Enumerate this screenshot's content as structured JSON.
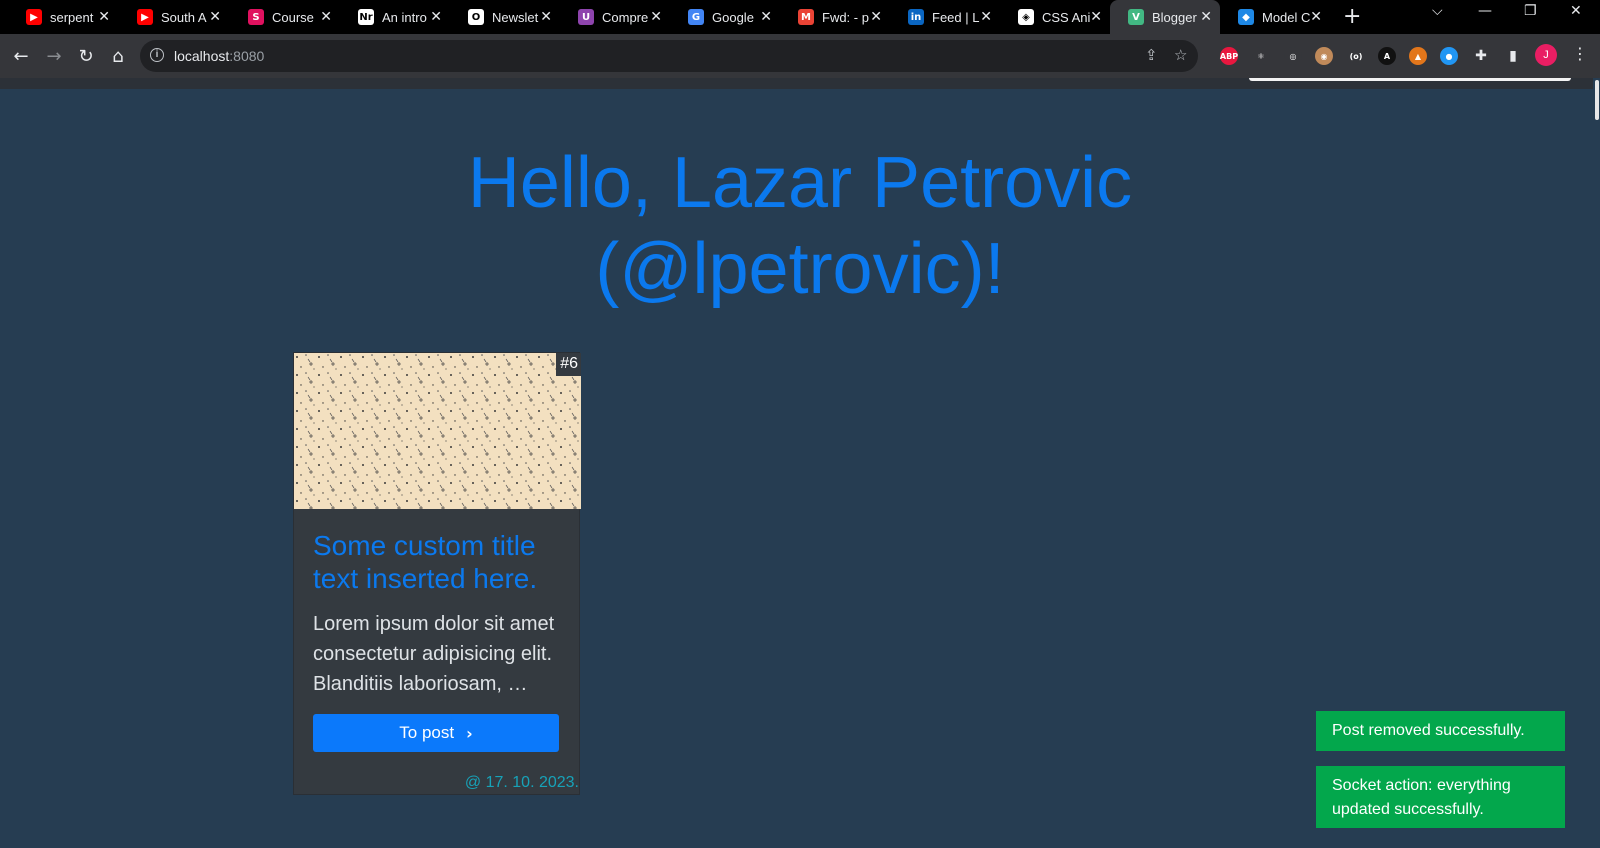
{
  "browser": {
    "tabs": [
      {
        "title": "serpent",
        "favicon": "youtube-icon",
        "color": "#ff0000",
        "glyph": "▶"
      },
      {
        "title": "South A",
        "favicon": "youtube-icon",
        "color": "#ff0000",
        "glyph": "▶"
      },
      {
        "title": "Course",
        "favicon": "course-icon",
        "color": "#e0115f",
        "glyph": "S"
      },
      {
        "title": "An intro",
        "favicon": "nr-icon",
        "color": "#ffffff",
        "glyph": "Nr"
      },
      {
        "title": "Newslet",
        "favicon": "newsletter-icon",
        "color": "#ffffff",
        "glyph": "O"
      },
      {
        "title": "Compre",
        "favicon": "compress-icon",
        "color": "#8e44ad",
        "glyph": "U"
      },
      {
        "title": "Google",
        "favicon": "google-translate-icon",
        "color": "#4285f4",
        "glyph": "G"
      },
      {
        "title": "Fwd: - p",
        "favicon": "gmail-icon",
        "color": "#ea4335",
        "glyph": "M"
      },
      {
        "title": "Feed | L",
        "favicon": "linkedin-icon",
        "color": "#0a66c2",
        "glyph": "in"
      },
      {
        "title": "CSS Ani",
        "favicon": "codepen-icon",
        "color": "#ffffff",
        "glyph": "◈"
      },
      {
        "title": "Blogger",
        "favicon": "vue-icon",
        "color": "#42b883",
        "glyph": "V"
      },
      {
        "title": "Model C",
        "favicon": "cube-icon",
        "color": "#1e88e5",
        "glyph": "◆"
      }
    ],
    "active_tab": 10,
    "url_host": "localhost",
    "url_port": ":8080",
    "profile_initial": "J",
    "extensions": [
      {
        "name": "adblock-plus-icon",
        "label": "ABP",
        "color": "#e8173f"
      },
      {
        "name": "react-devtools-icon",
        "label": "⚛",
        "color": "#35363a"
      },
      {
        "name": "target-icon",
        "label": "◎",
        "color": "#35363a"
      },
      {
        "name": "owl-extension-icon",
        "label": "◉",
        "color": "#c08a5a"
      },
      {
        "name": "code-extension-icon",
        "label": "(o)",
        "color": "#35363a"
      },
      {
        "name": "a-extension-icon",
        "label": "A",
        "color": "#111111"
      },
      {
        "name": "metamask-icon",
        "label": "▲",
        "color": "#e2761b"
      },
      {
        "name": "dots-extension-icon",
        "label": "●",
        "color": "#2196f3"
      }
    ]
  },
  "page": {
    "greeting_line1": "Hello, Lazar Petrovic",
    "greeting_line2": "(@lpetrovic)!",
    "post": {
      "id_label": "#6",
      "title": "Some custom title text inserted here.",
      "excerpt": "Lorem ipsum dolor sit amet consectetur adipisicing elit. Blanditiis laboriosam, …",
      "button_label": "To post",
      "date": "@ 17. 10. 2023."
    }
  },
  "toasts": [
    {
      "text": "Post removed successfully."
    },
    {
      "text": "Socket action: everything updated successfully."
    }
  ],
  "colors": {
    "page_bg": "#263d52",
    "accent": "#0b79ee",
    "toast_success": "#03a74c",
    "date": "#17a2b8"
  }
}
